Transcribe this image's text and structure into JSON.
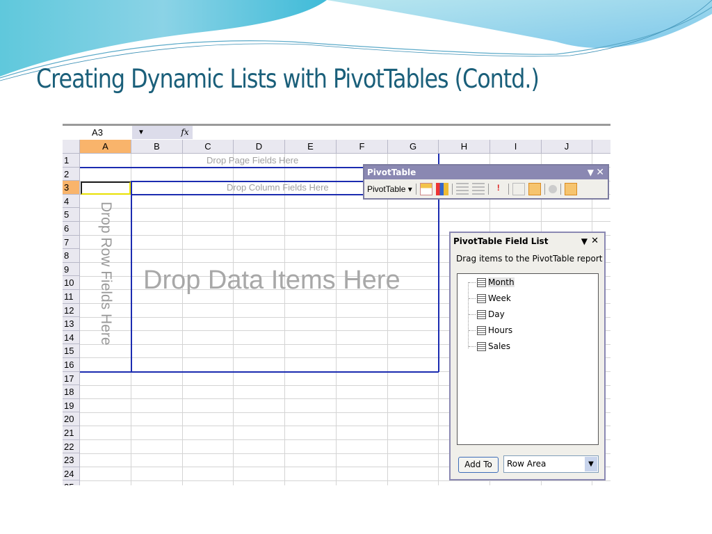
{
  "slide": {
    "title": "Creating Dynamic Lists with PivotTables (Contd.)"
  },
  "formula_bar": {
    "name_box": "A3",
    "dropdown": "▼",
    "fx": "fx"
  },
  "columns": [
    "A",
    "B",
    "C",
    "D",
    "E",
    "F",
    "G",
    "H",
    "I",
    "J",
    ""
  ],
  "rows": [
    "1",
    "2",
    "3",
    "4",
    "5",
    "6",
    "7",
    "8",
    "9",
    "10",
    "11",
    "12",
    "13",
    "14",
    "15",
    "16",
    "17",
    "18",
    "19",
    "20",
    "21",
    "22",
    "23",
    "24",
    "25"
  ],
  "selected": {
    "column": "A",
    "row": "3"
  },
  "pivot_areas": {
    "page": "Drop Page Fields Here",
    "column": "Drop Column Fields Here",
    "row": "Drop Row Fields Here",
    "data": "Drop Data Items Here"
  },
  "toolbar": {
    "title": "PivotTable",
    "menu": "PivotTable ▾",
    "menu_button": "PivotTable",
    "icons": [
      "format-report-icon",
      "chart-wizard-icon",
      "hide-detail-icon",
      "show-detail-icon",
      "refresh-data-icon",
      "include-hidden-icon",
      "always-display-items-icon",
      "field-settings-icon",
      "show-field-list-icon"
    ]
  },
  "field_list": {
    "title": "PivotTable Field List",
    "subtitle": "Drag items to the PivotTable report",
    "fields": [
      "Month",
      "Week",
      "Day",
      "Hours",
      "Sales"
    ],
    "add_button": "Add To",
    "area_value": "Row Area"
  },
  "colors": {
    "accent": "#1b2bb0",
    "title": "#1a5f7a",
    "selection": "#f9b46b",
    "titlebar": "#8a88b2"
  }
}
